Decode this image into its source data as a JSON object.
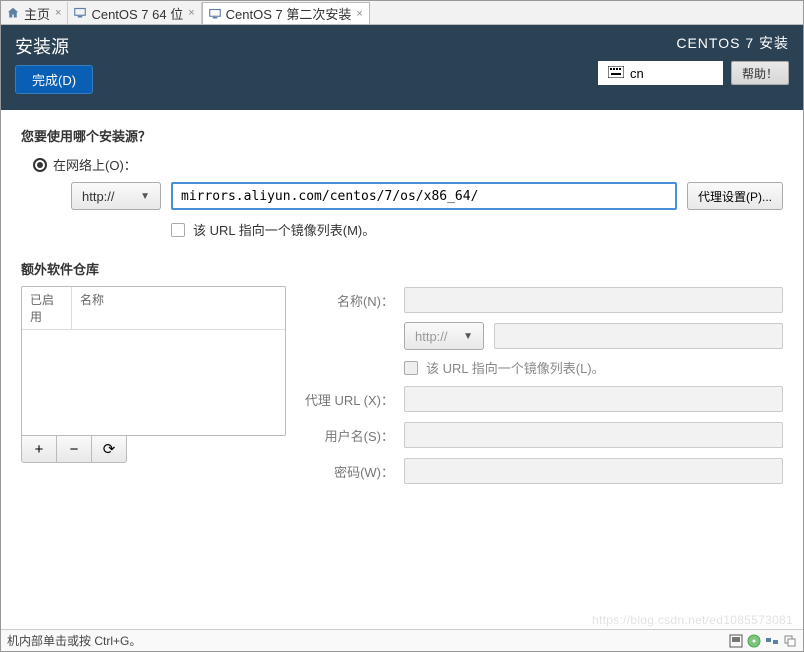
{
  "tabs": [
    {
      "label": "主页"
    },
    {
      "label": "CentOS 7 64 位"
    },
    {
      "label": "CentOS 7 第二次安装"
    }
  ],
  "header": {
    "title": "安装源",
    "done": "完成(D)",
    "right_title": "CENTOS 7 安装",
    "keyboard": "cn",
    "help": "帮助！"
  },
  "main": {
    "question": "您要使用哪个安装源？",
    "on_network": "在网络上(O)：",
    "protocol": "http://",
    "url_value": "mirrors.aliyun.com/centos/7/os/x86_64/",
    "proxy_setup": "代理设置(P)...",
    "mirror_check": "该 URL 指向一个镜像列表(M)。"
  },
  "extra": {
    "section": "额外软件仓库",
    "col_enabled": "已启用",
    "col_name": "名称",
    "tools": {
      "add": "+",
      "remove": "−",
      "refresh": "⟳"
    },
    "form": {
      "name_label": "名称(N)：",
      "protocol": "http://",
      "mirror_list": "该 URL 指向一个镜像列表(L)。",
      "proxy_url": "代理 URL (X)：",
      "username": "用户名(S)：",
      "password": "密码(W)："
    }
  },
  "watermark": "https://blog.csdn.net/ed1085573081",
  "bottom": {
    "hint": "机内部单击或按 Ctrl+G。"
  }
}
